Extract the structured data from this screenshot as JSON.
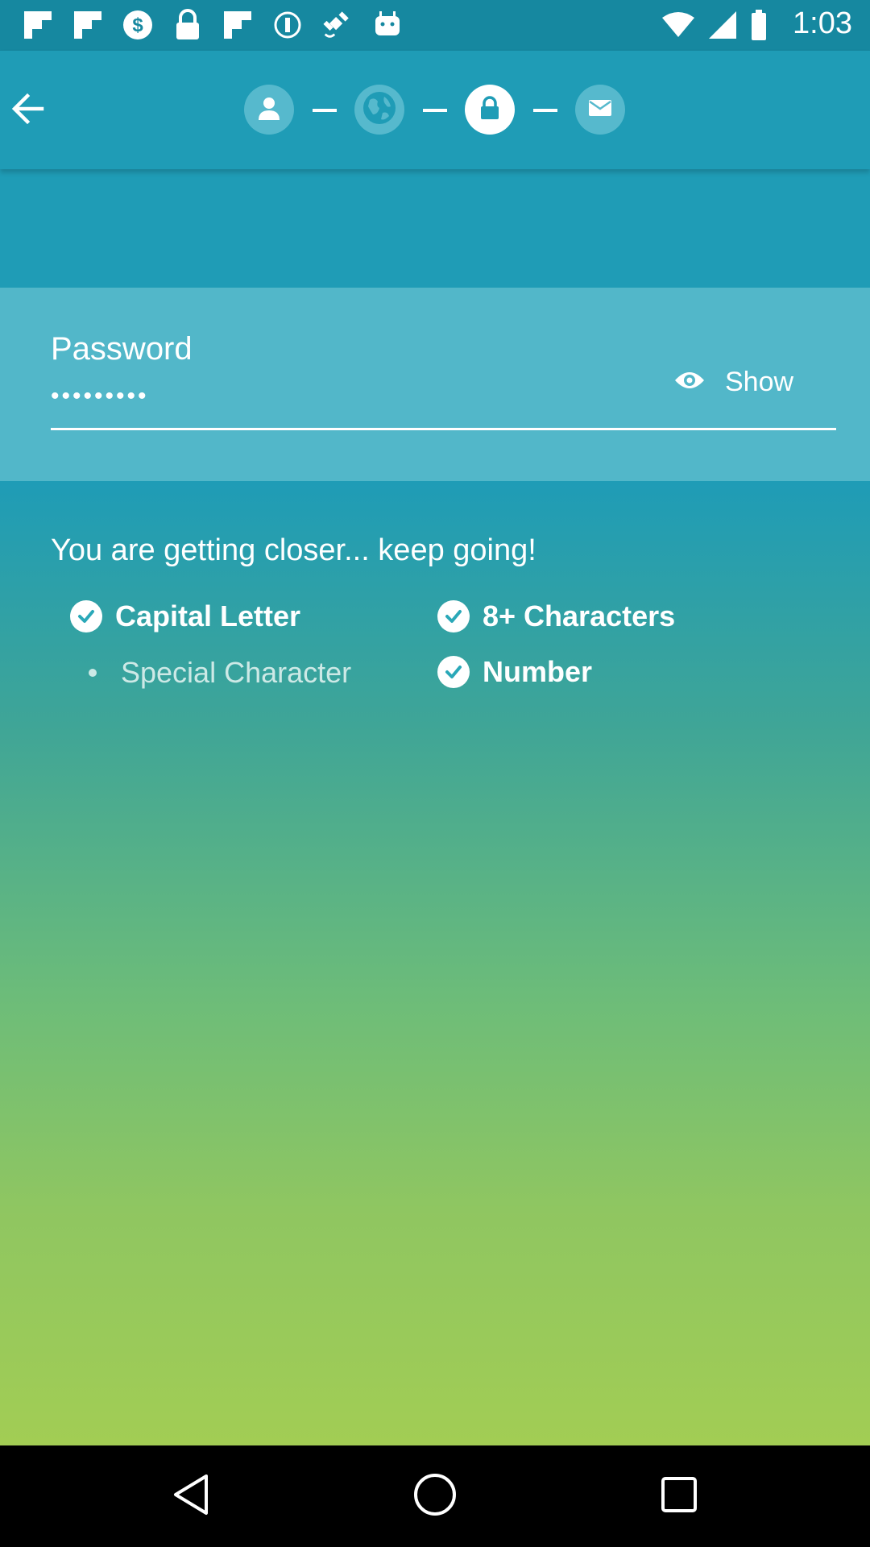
{
  "status_bar": {
    "time": "1:03",
    "left_icons": [
      "flipboard-icon",
      "flipboard-icon",
      "dollar-icon",
      "lock-icon",
      "flipboard-icon",
      "info-icon",
      "fake-gps-icon",
      "android-icon"
    ]
  },
  "toolbar": {
    "back_icon": "arrow-left-icon",
    "steps": [
      {
        "icon": "person-icon",
        "state": "inactive"
      },
      {
        "icon": "globe-icon",
        "state": "inactive"
      },
      {
        "icon": "lock-icon",
        "state": "active"
      },
      {
        "icon": "mail-icon",
        "state": "inactive"
      }
    ]
  },
  "password": {
    "label": "Password",
    "value": "•••••••••",
    "show_label": "Show"
  },
  "requirements": {
    "heading": "You are getting closer... keep going!",
    "items": [
      {
        "label": "Capital Letter",
        "met": true
      },
      {
        "label": "8+ Characters",
        "met": true
      },
      {
        "label": "Special Character",
        "met": false
      },
      {
        "label": "Number",
        "met": true
      }
    ]
  },
  "colors": {
    "primary": "#1f9cb6",
    "status_bar": "#1688a0",
    "panel": "#52b7c9",
    "gradient_end": "#a2cd54"
  }
}
